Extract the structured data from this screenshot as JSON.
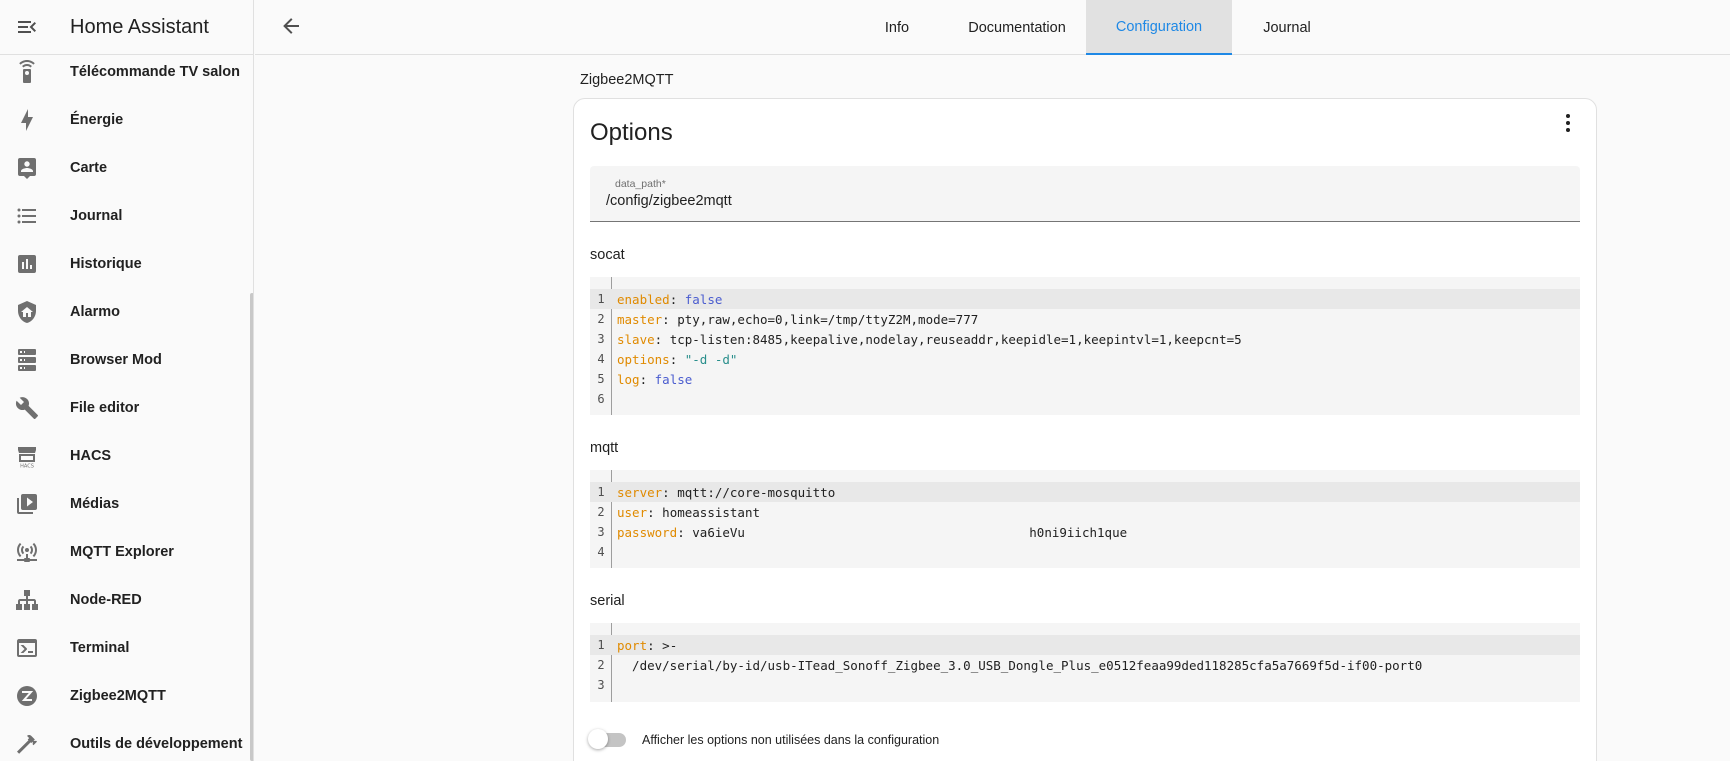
{
  "app": {
    "title": "Home Assistant"
  },
  "sidebar": {
    "items": [
      {
        "label": "Télécommande TV salon",
        "icon": "remote-icon"
      },
      {
        "label": "Énergie",
        "icon": "lightning-bolt-icon"
      },
      {
        "label": "Carte",
        "icon": "map-account-icon"
      },
      {
        "label": "Journal",
        "icon": "format-list-bulleted-icon"
      },
      {
        "label": "Historique",
        "icon": "chart-box-icon"
      },
      {
        "label": "Alarmo",
        "icon": "shield-home-icon"
      },
      {
        "label": "Browser Mod",
        "icon": "server-icon"
      },
      {
        "label": "File editor",
        "icon": "wrench-icon"
      },
      {
        "label": "HACS",
        "icon": "hacs-store-icon"
      },
      {
        "label": "Médias",
        "icon": "play-box-multiple-icon"
      },
      {
        "label": "MQTT Explorer",
        "icon": "access-point-network-icon"
      },
      {
        "label": "Node-RED",
        "icon": "sitemap-icon"
      },
      {
        "label": "Terminal",
        "icon": "console-icon"
      },
      {
        "label": "Zigbee2MQTT",
        "icon": "zigbee-icon"
      },
      {
        "label": "Outils de développement",
        "icon": "hammer-icon"
      }
    ]
  },
  "tabs": [
    {
      "label": "Info",
      "active": false
    },
    {
      "label": "Documentation",
      "active": false
    },
    {
      "label": "Configuration",
      "active": true
    },
    {
      "label": "Journal",
      "active": false
    }
  ],
  "addon": {
    "name": "Zigbee2MQTT"
  },
  "card": {
    "title": "Options",
    "data_path": {
      "label": "data_path*",
      "value": "/config/zigbee2mqtt"
    },
    "socat": {
      "label": "socat",
      "lines": [
        {
          "key": "enabled",
          "value": "false"
        },
        {
          "key": "master",
          "value": "pty,raw,echo=0,link=/tmp/ttyZ2M,mode=777"
        },
        {
          "key": "slave",
          "value": "tcp-listen:8485,keepalive,nodelay,reuseaddr,keepidle=1,keepintvl=1,keepcnt=5"
        },
        {
          "key": "options",
          "value": "\"-d -d\""
        },
        {
          "key": "log",
          "value": "false"
        }
      ]
    },
    "mqtt": {
      "label": "mqtt",
      "lines": [
        {
          "key": "server",
          "value": "mqtt://core-mosquitto"
        },
        {
          "key": "user",
          "value": "homeassistant"
        },
        {
          "key": "password",
          "value": "va6ieVu",
          "value2": "h0ni9iich1que"
        }
      ]
    },
    "serial": {
      "label": "serial",
      "lines": [
        {
          "key": "port",
          "value": ">-"
        },
        {
          "text": "  /dev/serial/by-id/usb-ITead_Sonoff_Zigbee_3.0_USB_Dongle_Plus_e0512feaa99ded118285cfa5a7669f5d-if00-port0"
        }
      ]
    },
    "show_unused": {
      "label": "Afficher les options non utilisées dans la configuration",
      "checked": false
    }
  },
  "line_numbers": [
    "1",
    "2",
    "3",
    "4",
    "5",
    "6"
  ],
  "colors": {
    "accent": "#1e88e5",
    "yaml_key": "#e08a00",
    "yaml_bool": "#4a5ccf",
    "yaml_string": "#2a8f8c"
  }
}
